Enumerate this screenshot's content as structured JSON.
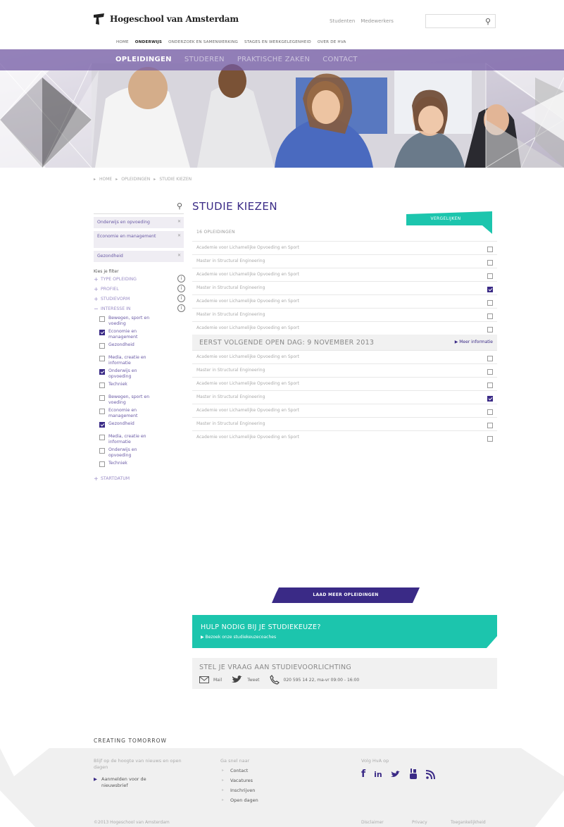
{
  "header": {
    "logo_text": "Hogeschool van Amsterdam",
    "top_links": [
      "Studenten",
      "Medewerkers"
    ],
    "search_icon": "search-icon",
    "nav": [
      "HOME",
      "ONDERWIJS",
      "ONDERZOEK EN SAMENWERKING",
      "STAGES EN WERKGELEGENHEID",
      "OVER DE HVA"
    ],
    "nav_active": "ONDERWIJS"
  },
  "subnav": {
    "items": [
      "OPLEIDINGEN",
      "STUDEREN",
      "PRAKTISCHE ZAKEN",
      "CONTACT"
    ],
    "active": "OPLEIDINGEN"
  },
  "breadcrumb": [
    "HOME",
    "OPLEIDINGEN",
    "STUDIE KIEZEN"
  ],
  "sidebar": {
    "search_icon": "search-icon",
    "topics": [
      "Onderwijs en opvoeding",
      "Economie en management",
      "Gezondheid"
    ],
    "filter_heading": "Kies je filter",
    "groups": [
      {
        "label": "TYPE OPLEIDING",
        "sign": "+"
      },
      {
        "label": "PROFIEL",
        "sign": "+"
      },
      {
        "label": "STUDIEVORM",
        "sign": "+"
      },
      {
        "label": "INTERESSE IN",
        "sign": "−"
      }
    ],
    "checkboxes": [
      {
        "label": "Bewegen, sport en voeding",
        "checked": false
      },
      {
        "label": "Economie en management",
        "checked": true
      },
      {
        "label": "Gezondheid",
        "checked": false
      },
      {
        "label": "Media, creatie en informatie",
        "checked": false
      },
      {
        "label": "Onderwijs en opvoeding",
        "checked": true
      },
      {
        "label": "Techniek",
        "checked": false
      },
      {
        "label": "Bewegen, sport en voeding",
        "checked": false
      },
      {
        "label": "Economie en management",
        "checked": false
      },
      {
        "label": "Gezondheid",
        "checked": true
      },
      {
        "label": "Media, creatie en informatie",
        "checked": false
      },
      {
        "label": "Onderwijs en opvoeding",
        "checked": false
      },
      {
        "label": "Techniek",
        "checked": false
      }
    ],
    "last_group": {
      "label": "STARTDATUM",
      "sign": "+"
    }
  },
  "main": {
    "title": "STUDIE KIEZEN",
    "compare_button": "VERGELIJKEN",
    "count_label": "16 OPLEIDINGEN",
    "rows_a": [
      {
        "label": "Academie voor Lichamelijke Opvoeding en Sport",
        "checked": false
      },
      {
        "label": "Master in Structural Engineering",
        "checked": false
      },
      {
        "label": "Academie voor Lichamelijke Opvoeding en Sport",
        "checked": false
      },
      {
        "label": "Master in Structural Engineering",
        "checked": true
      },
      {
        "label": "Academie voor Lichamelijke Opvoeding en Sport",
        "checked": false
      },
      {
        "label": "Master in Structural Engineering",
        "checked": false
      },
      {
        "label": "Academie voor Lichamelijke Opvoeding en Sport",
        "checked": false
      }
    ],
    "openday_title": "EERST VOLGENDE OPEN DAG: 9 NOVEMBER 2013",
    "openday_more": "Meer informatie",
    "rows_b": [
      {
        "label": "Academie voor Lichamelijke Opvoeding en Sport",
        "checked": false
      },
      {
        "label": "Master in Structural Engineering",
        "checked": false
      },
      {
        "label": "Academie voor Lichamelijke Opvoeding en Sport",
        "checked": false
      },
      {
        "label": "Master in Structural Engineering",
        "checked": true
      },
      {
        "label": "Academie voor Lichamelijke Opvoeding en Sport",
        "checked": false
      },
      {
        "label": "Master in Structural Engineering",
        "checked": false
      },
      {
        "label": "Academie voor Lichamelijke Opvoeding en Sport",
        "checked": false
      }
    ],
    "load_more": "LAAD MEER OPLEIDINGEN",
    "help_title": "HULP NODIG BIJ JE STUDIEKEUZE?",
    "help_sub": "Bezoek onze studiekeuzecoaches",
    "ask_title": "STEL JE VRAAG AAN STUDIEVOORLICHTING",
    "ask_mail": "Mail",
    "ask_tweet": "Tweet",
    "ask_phone": "020 595 14 22, ma-vr 09:00 - 16:00"
  },
  "footer": {
    "tagline": "CREATING TOMORROW",
    "col1_text": "Blijf op de hoogte van nieuws en open dagen",
    "col1_link": "Aanmelden voor de nieuwsbrief",
    "col2_head": "Ga snel naar",
    "col2_links": [
      "Contact",
      "Vacatures",
      "Inschrijven",
      "Open dagen"
    ],
    "col3_head": "Volg HvA op",
    "social_icons": [
      "facebook-icon",
      "linkedin-icon",
      "twitter-icon",
      "youtube-icon",
      "rss-icon"
    ],
    "copyright": "©2013 Hogeschool van Amsterdam",
    "bottom_links": [
      "Disclaimer",
      "Privacy",
      "Toegankelijkheid"
    ]
  },
  "colors": {
    "purple": "#3a2a86",
    "teal": "#1cc5ad",
    "lilac": "#735aa5"
  }
}
